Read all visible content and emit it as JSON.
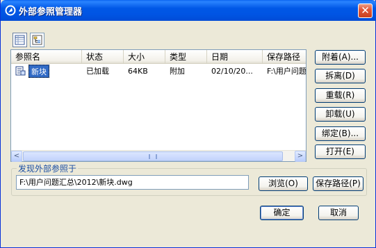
{
  "window": {
    "title": "外部参照管理器",
    "close_label": "✕"
  },
  "toolbar": {
    "list_view_icon": "list-view-icon",
    "tree_view_icon": "tree-view-icon"
  },
  "list": {
    "columns": [
      "参照名",
      "状态",
      "大小",
      "类型",
      "日期",
      "保存路径"
    ],
    "rows": [
      {
        "name": "新块",
        "status": "已加载",
        "size": "64KB",
        "type": "附加",
        "date": "02/10/20...",
        "path": "F:\\用户问题..."
      }
    ],
    "scroll_left": "<",
    "scroll_right": ">"
  },
  "actions": {
    "attach": "附着(A)...",
    "detach": "拆离(D)",
    "reload": "重载(R)",
    "unload": "卸载(U)",
    "bind": "绑定(B)...",
    "open": "打开(E)"
  },
  "found_at": {
    "label": "发现外部参照于",
    "value": "F:\\用户问题汇总\\2012\\新块.dwg",
    "browse": "浏览(O)",
    "save_path": "保存路径(P)"
  },
  "footer": {
    "ok": "确定",
    "cancel": "取消"
  },
  "colors": {
    "title_bar": "#0054e3",
    "selection": "#316ac5",
    "dialog_bg": "#ece9d8"
  }
}
